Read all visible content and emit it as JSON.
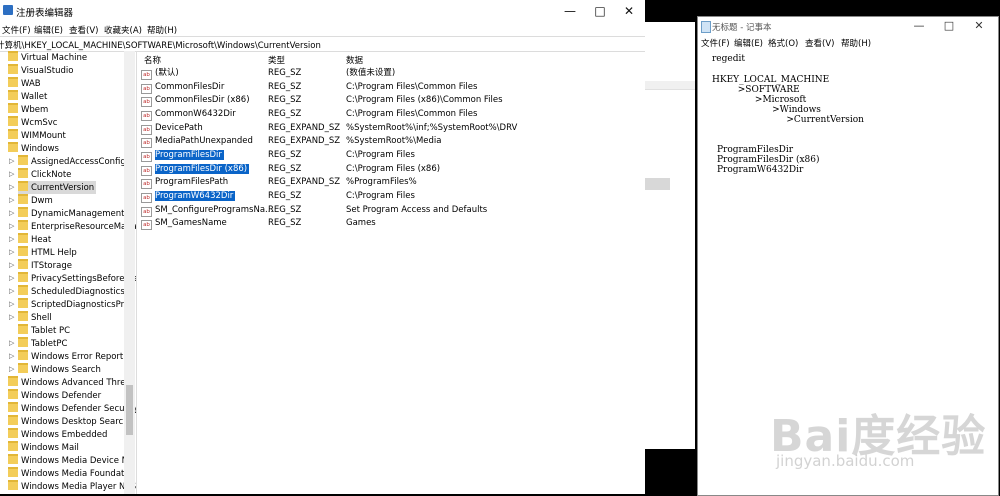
{
  "regedit": {
    "title": "注册表编辑器",
    "menu": [
      "文件(F)",
      "编辑(E)",
      "查看(V)",
      "收藏夹(A)",
      "帮助(H)"
    ],
    "address": "计算机\\HKEY_LOCAL_MACHINE\\SOFTWARE\\Microsoft\\Windows\\CurrentVersion",
    "tree": [
      {
        "label": "Virtual Machine"
      },
      {
        "label": "VisualStudio"
      },
      {
        "label": "WAB"
      },
      {
        "label": "Wallet"
      },
      {
        "label": "Wbem"
      },
      {
        "label": "WcmSvc"
      },
      {
        "label": "WIMMount"
      },
      {
        "label": "Windows"
      },
      {
        "label": "AssignedAccessConfigu"
      },
      {
        "label": "ClickNote"
      },
      {
        "label": "CurrentVersion"
      },
      {
        "label": "Dwm"
      },
      {
        "label": "DynamicManagement"
      },
      {
        "label": "EnterpriseResourceMana"
      },
      {
        "label": "Heat"
      },
      {
        "label": "HTML Help"
      },
      {
        "label": "ITStorage"
      },
      {
        "label": "PrivacySettingsBeforeCre"
      },
      {
        "label": "ScheduledDiagnostics"
      },
      {
        "label": "ScriptedDiagnosticsProv"
      },
      {
        "label": "Shell"
      },
      {
        "label": "Tablet PC"
      },
      {
        "label": "TabletPC"
      },
      {
        "label": "Windows Error Reportin"
      },
      {
        "label": "Windows Search"
      },
      {
        "label": "Windows Advanced Threat"
      },
      {
        "label": "Windows Defender"
      },
      {
        "label": "Windows Defender Security"
      },
      {
        "label": "Windows Desktop Search"
      },
      {
        "label": "Windows Embedded"
      },
      {
        "label": "Windows Mail"
      },
      {
        "label": "Windows Media Device Ma"
      },
      {
        "label": "Windows Media Foundatio"
      },
      {
        "label": "Windows Media Player NSS"
      }
    ],
    "columns": [
      "名称",
      "类型",
      "数据"
    ],
    "values": [
      {
        "name": "(默认)",
        "type": "REG_SZ",
        "data": "(数值未设置)"
      },
      {
        "name": "CommonFilesDir",
        "type": "REG_SZ",
        "data": "C:\\Program Files\\Common Files"
      },
      {
        "name": "CommonFilesDir (x86)",
        "type": "REG_SZ",
        "data": "C:\\Program Files (x86)\\Common Files"
      },
      {
        "name": "CommonW6432Dir",
        "type": "REG_SZ",
        "data": "C:\\Program Files\\Common Files"
      },
      {
        "name": "DevicePath",
        "type": "REG_EXPAND_SZ",
        "data": "%SystemRoot%\\inf;%SystemRoot%\\DRV"
      },
      {
        "name": "MediaPathUnexpanded",
        "type": "REG_EXPAND_SZ",
        "data": "%SystemRoot%\\Media"
      },
      {
        "name": "ProgramFilesDir",
        "type": "REG_SZ",
        "data": "C:\\Program Files"
      },
      {
        "name": "ProgramFilesDir (x86)",
        "type": "REG_SZ",
        "data": "C:\\Program Files (x86)"
      },
      {
        "name": "ProgramFilesPath",
        "type": "REG_EXPAND_SZ",
        "data": "%ProgramFiles%"
      },
      {
        "name": "ProgramW6432Dir",
        "type": "REG_SZ",
        "data": "C:\\Program Files"
      },
      {
        "name": "SM_ConfigureProgramsNa...",
        "type": "REG_SZ",
        "data": "Set Program Access and Defaults"
      },
      {
        "name": "SM_GamesName",
        "type": "REG_SZ",
        "data": "Games"
      }
    ]
  },
  "notepad": {
    "title": "无标题 - 记事本",
    "menu": [
      "文件(F)",
      "编辑(E)",
      "格式(O)",
      "查看(V)",
      "帮助(H)"
    ],
    "lines": [
      "regedit",
      "",
      "HKEY_LOCAL_MACHINE",
      "         >SOFTWARE",
      "               >Microsoft",
      "                     >Windows",
      "                          >CurrentVersion",
      "",
      "",
      "",
      "ProgramFilesDir",
      "ProgramFilesDir (x86)",
      "ProgramW6432Dir"
    ]
  },
  "watermark": {
    "logo": "Bai度经验",
    "url": "jingyan.baidu.com"
  },
  "icons": {
    "minimize": "minimize-icon",
    "maximize": "maximize-icon",
    "close": "close-icon",
    "folder": "folder-icon",
    "string-value": "string-value-icon"
  }
}
